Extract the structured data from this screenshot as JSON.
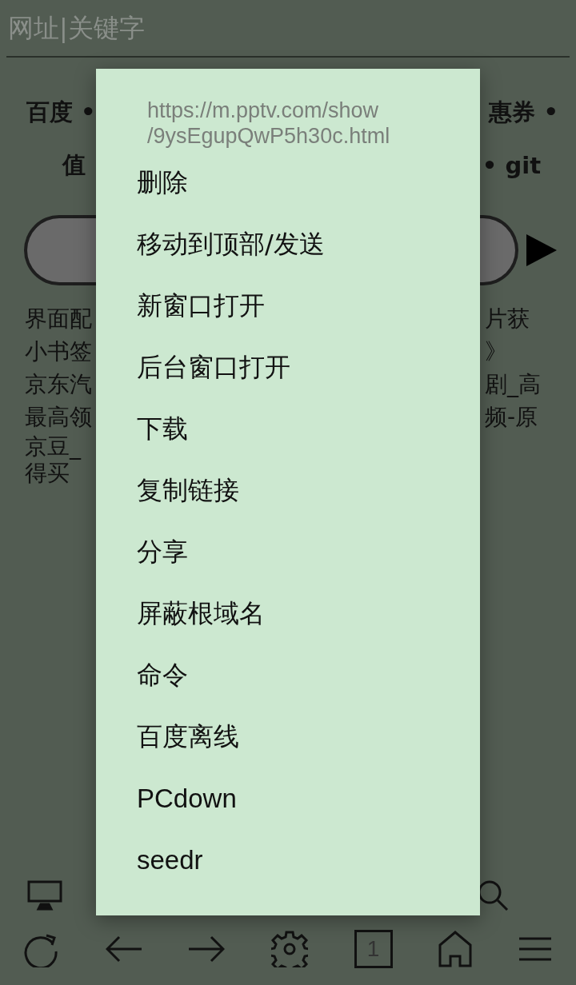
{
  "address_bar": {
    "placeholder": "网址|关键字"
  },
  "quick_links": [
    {
      "left": "百度 •",
      "right": "惠券 •"
    },
    {
      "left": "值",
      "right": "• git"
    }
  ],
  "bookmarks_left": [
    "界面配",
    "小书签",
    "京东汽",
    "最高领",
    "京豆_",
    "得买"
  ],
  "bookmarks_right": [
    "片获",
    "》",
    "剧_高",
    "频-原"
  ],
  "toolbar_top": [
    {
      "kind": "monitor"
    },
    {
      "kind": "search"
    }
  ],
  "toolbar_bottom": [
    {
      "kind": "refresh"
    },
    {
      "kind": "back"
    },
    {
      "kind": "forward"
    },
    {
      "kind": "settings"
    },
    {
      "kind": "tabs",
      "label": "1"
    },
    {
      "kind": "home"
    },
    {
      "kind": "menu"
    }
  ],
  "context_menu": {
    "url_lines": [
      "https://m.pptv.com/show",
      "/9ysEgupQwP5h30c.html"
    ],
    "items": [
      "删除",
      "移动到顶部/发送",
      "新窗口打开",
      "后台窗口打开",
      "下载",
      "复制链接",
      "分享",
      "屏蔽根域名",
      "命令",
      "百度离线",
      "PCdown",
      "seedr"
    ]
  }
}
